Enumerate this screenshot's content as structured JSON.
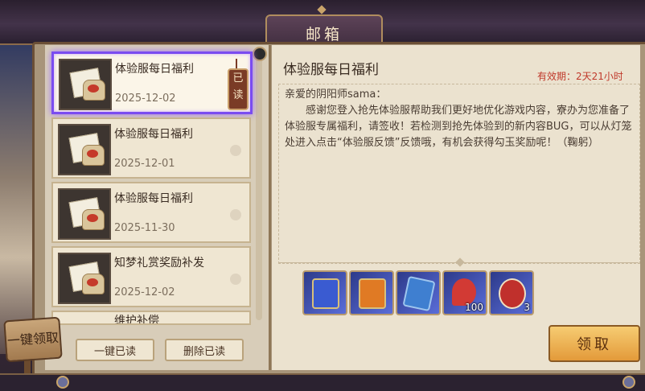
{
  "window": {
    "title": "邮箱"
  },
  "mail_list": [
    {
      "title": "体验服每日福利",
      "date": "2025-12-02",
      "selected": true,
      "read_tag": "已读"
    },
    {
      "title": "体验服每日福利",
      "date": "2025-12-01",
      "selected": false
    },
    {
      "title": "体验服每日福利",
      "date": "2025-11-30",
      "selected": false
    },
    {
      "title": "知梦礼赏奖励补发",
      "date": "2025-12-02",
      "selected": false
    },
    {
      "title": "维护补偿",
      "date": "",
      "selected": false
    }
  ],
  "list_actions": {
    "read_all": "一键已读",
    "delete_read": "删除已读"
  },
  "signpost": {
    "label": "一键领取"
  },
  "detail": {
    "title": "体验服每日福利",
    "expire": "有效期：2天21小时",
    "greeting": "亲爱的阴阳师sama：",
    "body": "感谢您登入抢先体验服帮助我们更好地优化游戏内容，寮办为您准备了体验服专属福利，请签收！若检测到抢先体验到的新内容BUG，可以从灯笼处进入点击“体验服反馈”反馈哦，有机会获得勾玉奖励呢！（鞠躬）",
    "items": [
      {
        "icon": "blue-charm-icon",
        "count": "",
        "color": "#3a5bd1"
      },
      {
        "icon": "orange-charm-icon",
        "count": "",
        "color": "#e07a24"
      },
      {
        "icon": "blue-scroll-icon",
        "count": "",
        "color": "#3f7fd0"
      },
      {
        "icon": "red-feather-icon",
        "count": "100",
        "color": "#d23a34"
      },
      {
        "icon": "daruma-icon",
        "count": "3",
        "color": "#c0302c"
      }
    ],
    "claim_button": "领取"
  }
}
